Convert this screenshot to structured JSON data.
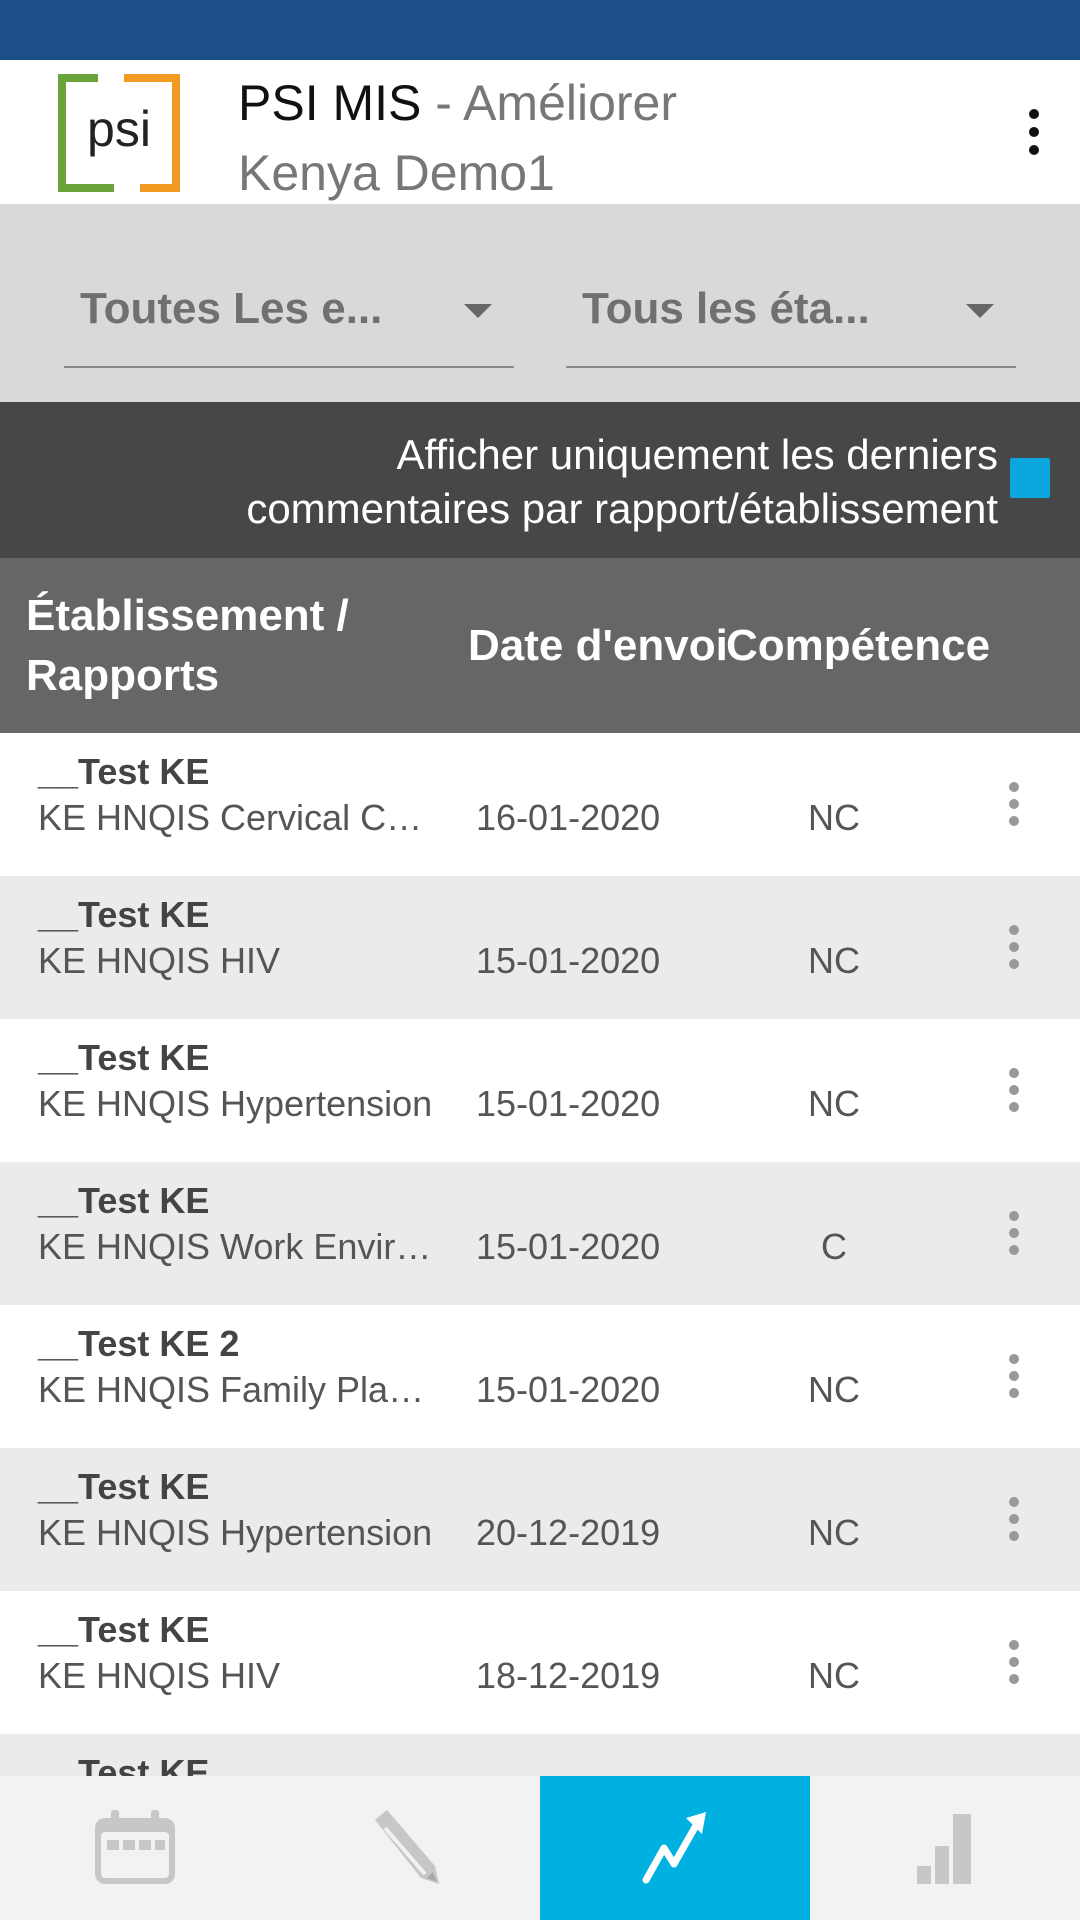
{
  "header": {
    "app_name": "PSI MIS",
    "separator": " - ",
    "module": "Améliorer",
    "program": "Kenya Demo1",
    "logo_text": "psi"
  },
  "filters": {
    "org_unit_dropdown": "Toutes Les e...",
    "status_dropdown": "Tous les éta..."
  },
  "latest_only": {
    "label_line1": "Afficher uniquement les derniers",
    "label_line2": "commentaires par rapport/établissement",
    "checked": true,
    "color": "#0aa6dd"
  },
  "table": {
    "headers": {
      "establishment_line1": "Établissement /",
      "establishment_line2": "Rapports",
      "date": "Date d'envoi",
      "competence": "Compétence"
    },
    "rows": [
      {
        "establishment": "__Test KE",
        "report": "KE HNQIS Cervical Can...",
        "date": "16-01-2020",
        "competence": "NC"
      },
      {
        "establishment": "__Test KE",
        "report": "KE HNQIS HIV",
        "date": "15-01-2020",
        "competence": "NC"
      },
      {
        "establishment": "__Test KE",
        "report": "KE HNQIS Hypertension",
        "date": "15-01-2020",
        "competence": "NC"
      },
      {
        "establishment": "__Test KE",
        "report": "KE HNQIS Work Environ...",
        "date": "15-01-2020",
        "competence": "C"
      },
      {
        "establishment": "__Test KE 2",
        "report": "KE HNQIS Family Plann...",
        "date": "15-01-2020",
        "competence": "NC"
      },
      {
        "establishment": "__Test KE",
        "report": "KE HNQIS Hypertension",
        "date": "20-12-2019",
        "competence": "NC"
      },
      {
        "establishment": "__Test KE",
        "report": "KE HNQIS HIV",
        "date": "18-12-2019",
        "competence": "NC"
      },
      {
        "establishment": "__Test KE",
        "report": "",
        "date": "",
        "competence": ""
      }
    ]
  },
  "bottom_nav": {
    "items": [
      "calendar-icon",
      "pencil-icon",
      "trend-icon",
      "bar-chart-icon"
    ],
    "active_index": 2,
    "active_color": "#00b0e0"
  },
  "colors": {
    "status_bar": "#1c4f8a",
    "filter_area": "#d9d9d9",
    "filter_bar": "#474747",
    "table_header": "#666666",
    "row_alt": "#ebebeb"
  }
}
